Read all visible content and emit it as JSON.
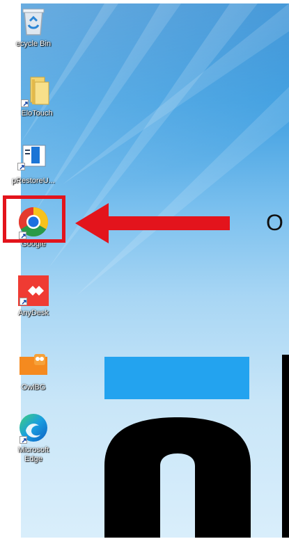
{
  "desktop": {
    "icons": [
      {
        "label": "ecycle Bin",
        "icon": "recycle-bin-icon"
      },
      {
        "label": "EloTouch",
        "icon": "folder-icon"
      },
      {
        "label": "pRestoreU...",
        "icon": "restore-utility-icon"
      },
      {
        "label": "Google",
        "icon": "chrome-icon"
      },
      {
        "label": "AnyDesk",
        "icon": "anydesk-icon"
      },
      {
        "label": "OwlBG",
        "icon": "owlbg-icon"
      },
      {
        "label": "Microsoft Edge",
        "icon": "edge-icon"
      }
    ]
  },
  "annotation": {
    "arrow_text": "O",
    "highlight_color": "#e3141c",
    "arrow_color": "#e3141c"
  },
  "colors": {
    "blue_block": "#23a3ef",
    "black_shape": "#000000"
  }
}
